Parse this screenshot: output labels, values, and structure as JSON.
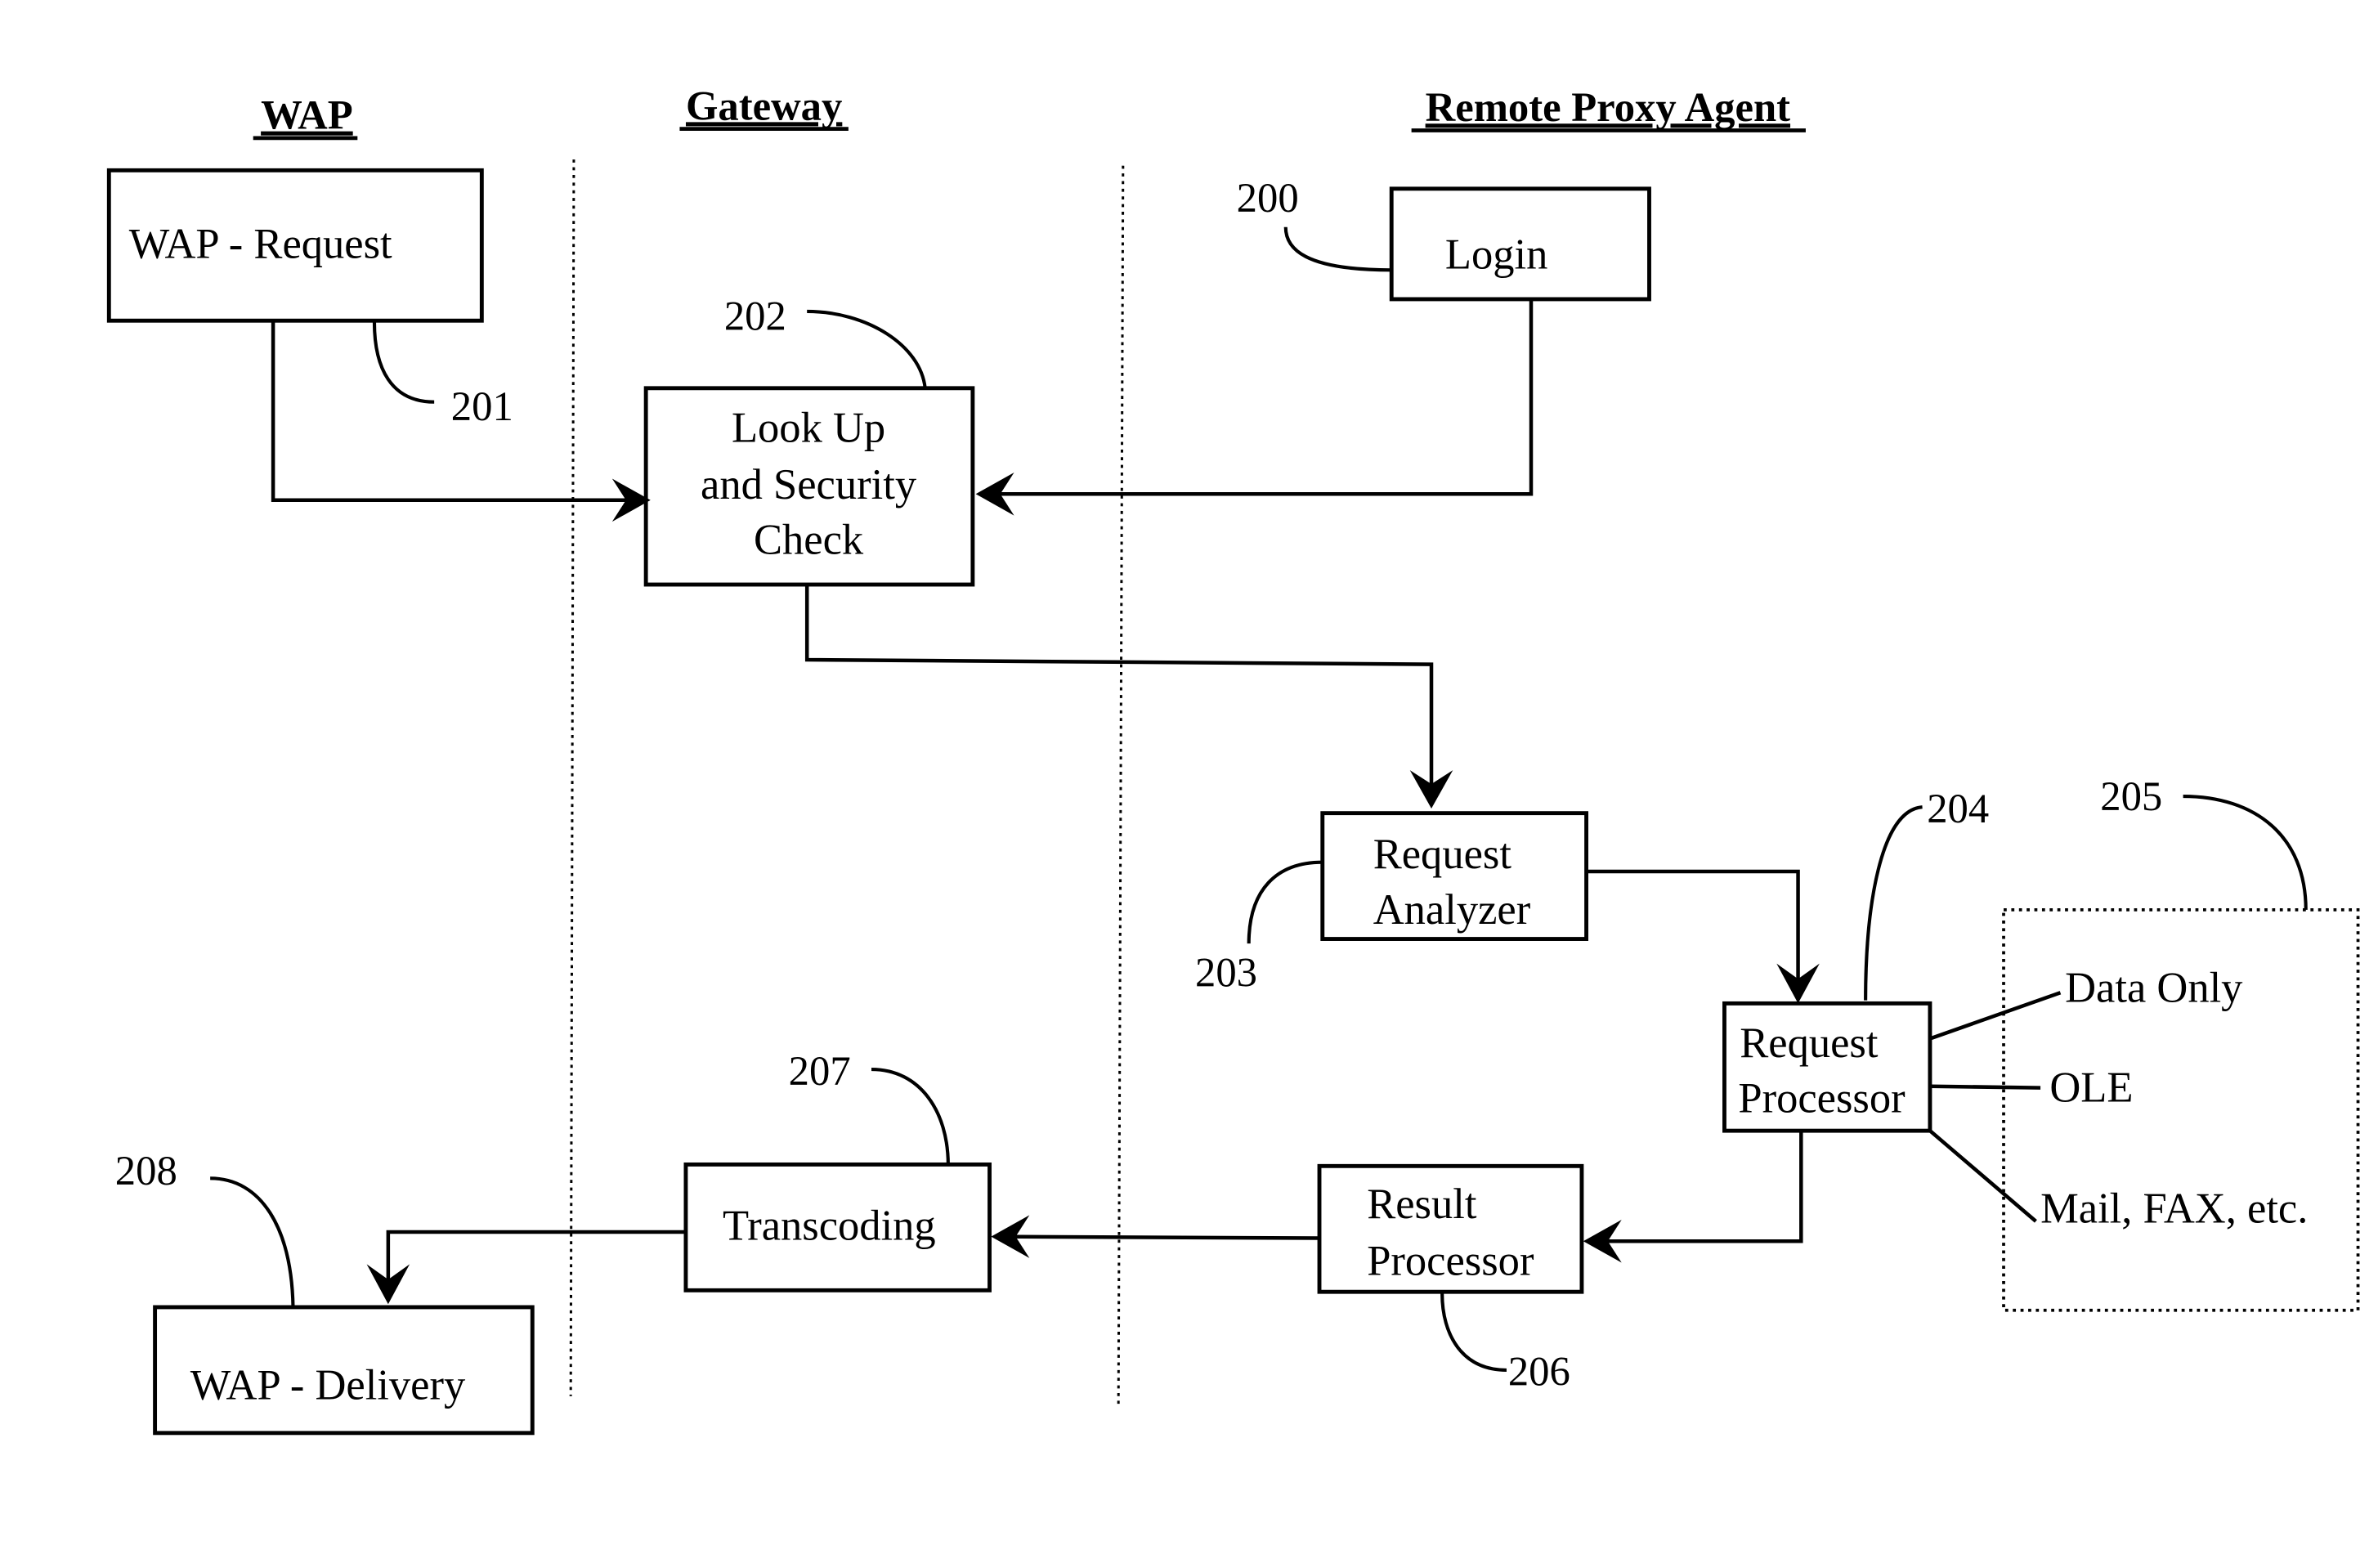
{
  "lanes": {
    "wap": "WAP",
    "gateway": "Gateway",
    "remote_proxy_agent": "Remote Proxy Agent"
  },
  "nodes": {
    "wap_request": {
      "label": "WAP - Request",
      "ref": "201"
    },
    "login": {
      "label": "Login",
      "ref": "200"
    },
    "lookup": {
      "lines": [
        "Look Up",
        "and Security",
        "Check"
      ],
      "ref": "202"
    },
    "request_analyzer": {
      "lines": [
        "Request",
        "Analyzer"
      ],
      "ref": "203"
    },
    "request_processor": {
      "lines": [
        "Request",
        "Processor"
      ],
      "ref": "204"
    },
    "options_group": {
      "ref": "205",
      "items": [
        "Data Only",
        "OLE",
        "Mail, FAX, etc."
      ]
    },
    "result_processor": {
      "lines": [
        "Result",
        "Processor"
      ],
      "ref": "206"
    },
    "transcoding": {
      "label": "Transcoding",
      "ref": "207"
    },
    "wap_delivery": {
      "label": "WAP - Delivery",
      "ref": "208"
    }
  },
  "edges": [
    {
      "from": "WAP - Request",
      "to": "Look Up and Security Check"
    },
    {
      "from": "Login",
      "to": "Look Up and Security Check"
    },
    {
      "from": "Look Up and Security Check",
      "to": "Request Analyzer"
    },
    {
      "from": "Request Analyzer",
      "to": "Request Processor"
    },
    {
      "from": "Request Processor",
      "to": "Result Processor"
    },
    {
      "from": "Result Processor",
      "to": "Transcoding"
    },
    {
      "from": "Transcoding",
      "to": "WAP - Delivery"
    }
  ]
}
